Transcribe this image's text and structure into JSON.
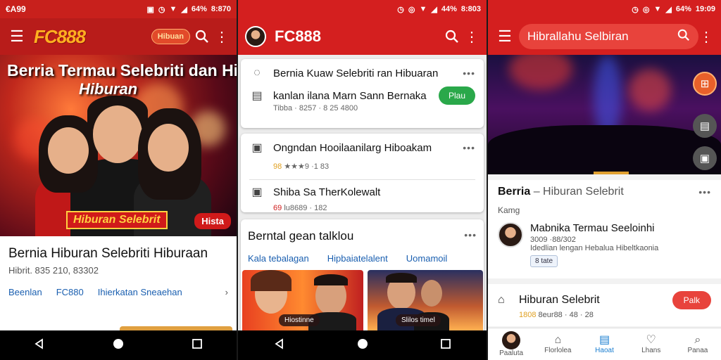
{
  "screen1": {
    "status_time": "€A99",
    "status_battery": "64%",
    "status_clock": "8:870",
    "logo": "FC888",
    "pill_label": "Hibuan",
    "hero_title": "Berria Termau Selebriti dan Hi",
    "hero_subtitle": "Hiburan",
    "hero_badge": "Hiburan Selebrit",
    "hero_badge2": "Hista",
    "article_title": "Bernia Hiburan Selebriti Hiburaan",
    "article_meta": "Hibrit. 835 210, 83302",
    "links": [
      "Beenlan",
      "FC880",
      "Ihierkatan Sneaehan"
    ]
  },
  "screen2": {
    "status_battery": "44%",
    "status_clock": "8:803",
    "logo": "FC888",
    "card1": {
      "row1": "Bernia Kuaw Selebriti ran Hibuaran",
      "row2": "kanlan ilana Marn Sann Bernaka",
      "meta": "Tibba · 8257 · 8 25 4800",
      "button": "Plau"
    },
    "card2": {
      "row1": "Ongndan Hooilaanilarg Hiboakam",
      "meta1_prefix": "98",
      "meta1": "★★★9 ·1 83",
      "row2": "Shiba Sa TherKolewalt",
      "meta2_prefix": "69",
      "meta2": "lu8689 · 182"
    },
    "section": {
      "title": "Berntal gean talklou",
      "links": [
        "Kala tebalagan",
        "Hipbaiatelalent",
        "Uomamoil"
      ]
    },
    "tiles": [
      "Hiostinne",
      "Slilos timel"
    ]
  },
  "screen3": {
    "status_battery": "64%",
    "status_clock": "19:09",
    "search_text": "Hibrallahu Selbiran",
    "panel1": {
      "title_bold": "Berria",
      "title_rest": "– Hiburan Selebrit",
      "sub": "Kamg",
      "author_title": "Mabnika Termau Seeloinhi",
      "author_meta": "3009 ·88/302",
      "author_desc": "Idedlian lengan Hebalua Hibeltkaonia",
      "tag": "8 tate"
    },
    "panel2": {
      "title": "Hiburan Selebrit",
      "meta_prefix": "1808",
      "meta": "8eur88 · 48 · 28",
      "button": "Palk"
    },
    "bottom_nav": [
      "Paaluta",
      "Florlolea",
      "Haoat",
      "Lhans",
      "Panaa"
    ]
  },
  "colors": {
    "brand_red": "#d41f1f",
    "accent_gold": "#ffb020",
    "link_blue": "#1a5fb0",
    "green": "#2aa84a"
  }
}
